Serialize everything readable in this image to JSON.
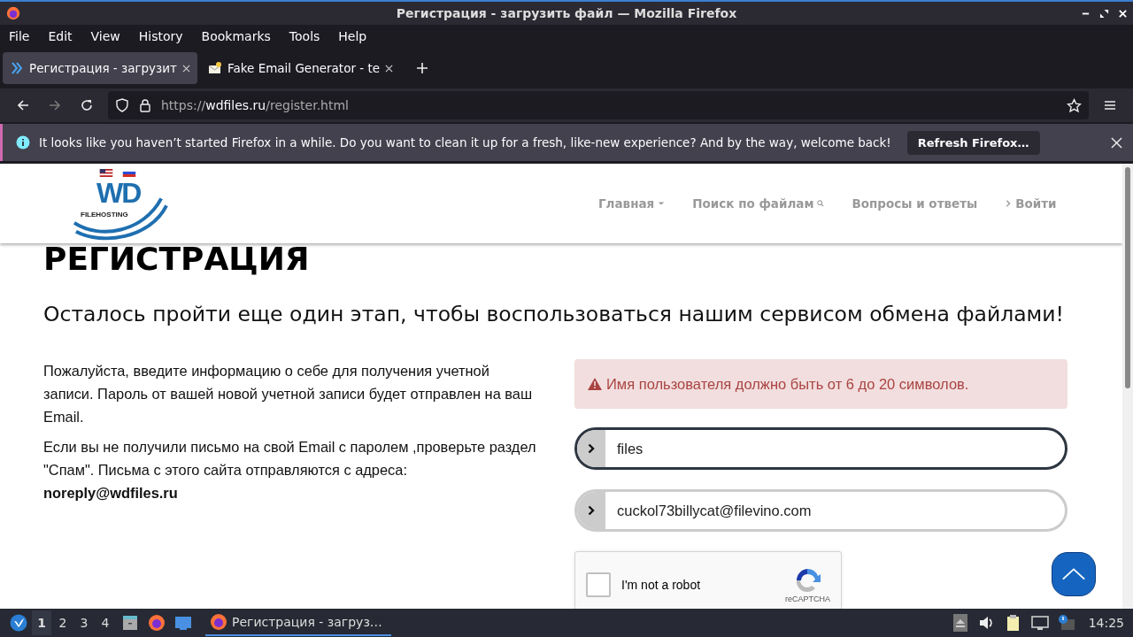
{
  "window": {
    "title": "Регистрация - загрузить файл — Mozilla Firefox"
  },
  "menu": [
    "File",
    "Edit",
    "View",
    "History",
    "Bookmarks",
    "Tools",
    "Help"
  ],
  "tabs": [
    {
      "label": "Регистрация - загрузит",
      "selected": true,
      "kind": "site"
    },
    {
      "label": "Fake Email Generator - te",
      "selected": false,
      "kind": "mail"
    }
  ],
  "address": {
    "scheme": "https://",
    "domain": "wdfiles.ru",
    "path": "/register.html"
  },
  "notification": {
    "text": "It looks like you haven’t started Firefox in a while. Do you want to clean it up for a fresh, like-new experience? And by the way, welcome back!",
    "button": "Refresh Firefox…"
  },
  "site": {
    "logo": {
      "mark": "WD",
      "sub": "FILEHOSTING"
    },
    "nav": [
      {
        "label": "Главная",
        "kind": "dropdown"
      },
      {
        "label": "Поиск по файлам",
        "kind": "search"
      },
      {
        "label": "Вопросы и ответы",
        "kind": "plain"
      },
      {
        "label": "Войти",
        "kind": "login"
      }
    ],
    "heading": "РЕГИСТРАЦИЯ",
    "subheading": "Осталось пройти еще один этап, чтобы воспользоваться нашим сервисом обмена файлами!",
    "paragraphs": [
      "Пожалуйста, введите информацию о себе для получения учетной записи. Пароль от вашей новой учетной записи будет отправлен на ваш Email.",
      "Если вы не получили письмо на свой Email с паролем ,проверьте раздел \"Спам\". Письма с этого сайта отправляются с адреса: **noreply@wdfiles.ru**"
    ],
    "alert": "Имя пользователя должно быть от 6 до 20 символов.",
    "fields": [
      {
        "value": "files",
        "focused": true
      },
      {
        "value": "cuckol73billycat@filevino.com",
        "focused": false
      }
    ],
    "captcha": {
      "label": "I'm not a robot",
      "brand": "reCAPTCHA",
      "checked": false
    }
  },
  "taskbar": {
    "workspaces": [
      {
        "label": "1",
        "selected": true
      },
      {
        "label": "2",
        "selected": false
      },
      {
        "label": "3",
        "selected": false
      },
      {
        "label": "4",
        "selected": false
      }
    ],
    "task": "Регистрация - загруз…",
    "clock": "14:25"
  }
}
